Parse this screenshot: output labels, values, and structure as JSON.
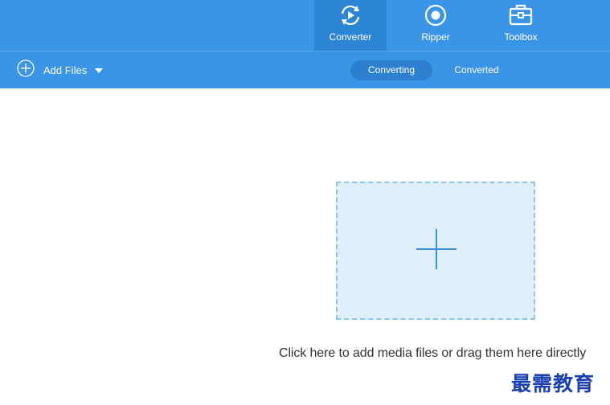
{
  "nav": {
    "tabs": [
      {
        "label": "Converter",
        "icon": "convert-cycle-icon",
        "active": true
      },
      {
        "label": "Ripper",
        "icon": "disc-icon",
        "active": false
      },
      {
        "label": "Toolbox",
        "icon": "toolbox-icon",
        "active": false
      }
    ]
  },
  "toolbar": {
    "add_files_label": "Add Files",
    "subtabs": [
      {
        "label": "Converting",
        "active": true
      },
      {
        "label": "Converted",
        "active": false
      }
    ]
  },
  "main": {
    "hint": "Click here to add media files or drag them here directly"
  },
  "watermark": "最需教育",
  "colors": {
    "header_bg": "#3b95e6",
    "active_tab_bg": "#2d85d6",
    "dropzone_bg": "#dff0fc",
    "dropzone_border": "#8fc3ea",
    "watermark": "#1a3fb0"
  }
}
